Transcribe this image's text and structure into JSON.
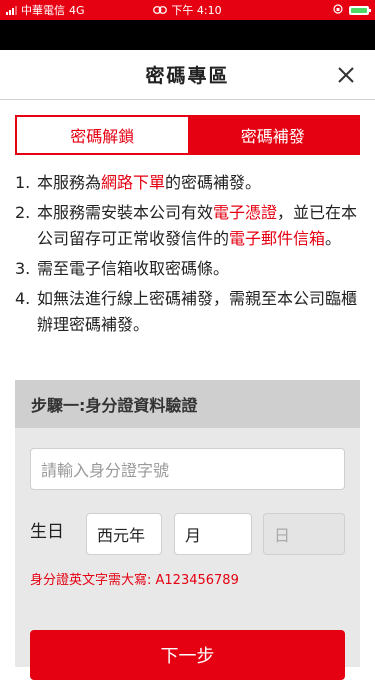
{
  "status_bar": {
    "carrier": "中華電信",
    "network": "4G",
    "time": "下午 4:10"
  },
  "header": {
    "title": "密碼專區",
    "close_icon": "close-icon"
  },
  "tabs": [
    {
      "label": "密碼解鎖",
      "active": false
    },
    {
      "label": "密碼補發",
      "active": true
    }
  ],
  "notes": [
    {
      "num": "1.",
      "before": "本服務為",
      "highlight": "網路下單",
      "after": "的密碼補發。"
    },
    {
      "num": "2.",
      "before": "本服務需安裝本公司有效",
      "highlight": "電子憑證",
      "middle": "，並已在本公司留存可正常收發信件的",
      "highlight2": "電子郵件信箱",
      "after": "。"
    },
    {
      "num": "3.",
      "text": "需至電子信箱收取密碼條。"
    },
    {
      "num": "4.",
      "text": "如無法進行線上密碼補發，需親至本公司臨櫃辦理密碼補發。"
    }
  ],
  "step_panel": {
    "title": "步驟一:身分證資料驗證",
    "id_placeholder": "請輸入身分證字號",
    "birthday_label": "生日",
    "year_value": "西元年",
    "month_value": "月",
    "day_value": "日",
    "hint": "身分證英文字需大寫: A123456789",
    "next_label": "下一步"
  },
  "colors": {
    "accent": "#e50012",
    "panel_bg": "#e8e8e8",
    "panel_header_bg": "#cfcfcf"
  }
}
